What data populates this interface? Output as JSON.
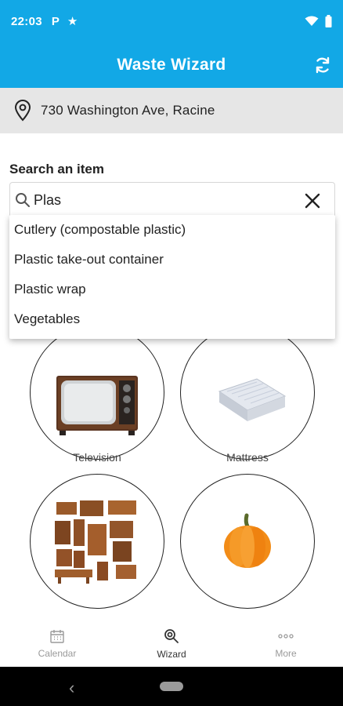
{
  "status_bar": {
    "time": "22:03",
    "p_icon": "P"
  },
  "app_bar": {
    "title": "Waste Wizard",
    "refresh_icon": "refresh-icon"
  },
  "address": {
    "text": "730 Washington Ave, Racine",
    "icon": "location-pin-icon"
  },
  "search": {
    "label": "Search an item",
    "value": "Plas",
    "placeholder": ""
  },
  "dropdown": {
    "items": [
      {
        "label": "Cutlery (compostable plastic)"
      },
      {
        "label": "Plastic take-out container"
      },
      {
        "label": "Plastic wrap"
      },
      {
        "label": "Vegetables"
      }
    ]
  },
  "items": [
    {
      "label": "Television"
    },
    {
      "label": "Mattress"
    },
    {
      "label": "Furniture"
    },
    {
      "label": "Pumpkin"
    }
  ],
  "bottom_nav": {
    "items": [
      {
        "label": "Calendar",
        "icon": "calendar-icon"
      },
      {
        "label": "Wizard",
        "icon": "wizard-search-icon"
      },
      {
        "label": "More",
        "icon": "more-dots-icon"
      }
    ],
    "active": "Wizard"
  },
  "colors": {
    "accent": "#12a8e6",
    "address_bg": "#e6e6e6",
    "pumpkin": "#f28c17"
  }
}
